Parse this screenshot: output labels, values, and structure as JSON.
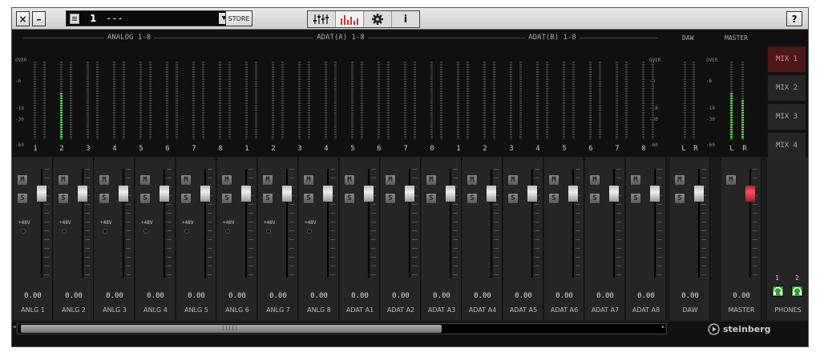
{
  "toolbar": {
    "close_glyph": "×",
    "minimize_glyph": "–",
    "preset_number": "1",
    "preset_name": "---",
    "dropdown_glyph": "▼",
    "store_label": "STORE",
    "help_label": "?",
    "modes": [
      {
        "icon": "mixer-faders-icon"
      },
      {
        "icon": "meter-bars-icon",
        "active": true
      },
      {
        "icon": "gear-icon"
      },
      {
        "label": "i",
        "icon": "info-icon"
      }
    ]
  },
  "meters": {
    "groups": [
      "ANALOG 1-8",
      "ADAT(A) 1-8",
      "ADAT(B) 1-8"
    ],
    "side_groups": [
      "DAW",
      "MASTER"
    ],
    "scale_labels": [
      "OVER",
      "-6",
      "-18",
      "-30",
      "-60"
    ],
    "channel_numbers": [
      "1",
      "2",
      "3",
      "4",
      "5",
      "6",
      "7",
      "8"
    ],
    "lr_labels": [
      "L",
      "R"
    ],
    "levels": {
      "anlg2": 0.6,
      "master_l": 0.6,
      "master_r": 0.5
    }
  },
  "mixes": [
    {
      "label": "MIX 1",
      "active": true
    },
    {
      "label": "MIX 2"
    },
    {
      "label": "MIX 3"
    },
    {
      "label": "MIX 4"
    }
  ],
  "strips": {
    "mute_label": "M",
    "solo_label": "S",
    "phantom_label": "+48V",
    "channels": [
      {
        "name": "ANLG 1",
        "value": "0.00"
      },
      {
        "name": "ANLG 2",
        "value": "0.00"
      },
      {
        "name": "ANLG 3",
        "value": "0.00"
      },
      {
        "name": "ANLG 4",
        "value": "0.00"
      },
      {
        "name": "ANLG 5",
        "value": "0.00"
      },
      {
        "name": "ANLG 6",
        "value": "0.00"
      },
      {
        "name": "ANLG 7",
        "value": "0.00"
      },
      {
        "name": "ANLG 8",
        "value": "0.00"
      },
      {
        "name": "ADAT A1",
        "value": "0.00"
      },
      {
        "name": "ADAT A2",
        "value": "0.00"
      },
      {
        "name": "ADAT A3",
        "value": "0.00"
      },
      {
        "name": "ADAT A4",
        "value": "0.00"
      },
      {
        "name": "ADAT A5",
        "value": "0.00"
      },
      {
        "name": "ADAT A6",
        "value": "0.00"
      },
      {
        "name": "ADAT A7",
        "value": "0.00"
      },
      {
        "name": "ADAT A8",
        "value": "0.00"
      }
    ],
    "daw": {
      "name": "DAW",
      "value": "0.00"
    },
    "master": {
      "name": "MASTER",
      "value": "0.00"
    }
  },
  "phones": {
    "label": "PHONES",
    "numbers": [
      "1",
      "2"
    ]
  },
  "brand": {
    "name": "steinberg"
  },
  "scroll": {
    "grip": "|||||",
    "left_arrow": "◂",
    "right_arrow": "▸"
  },
  "colors": {
    "meter_green": "#55d055",
    "fader_master": "#ff5060",
    "mix_active": "#ff8080",
    "phones_button": "#2ea12e"
  }
}
